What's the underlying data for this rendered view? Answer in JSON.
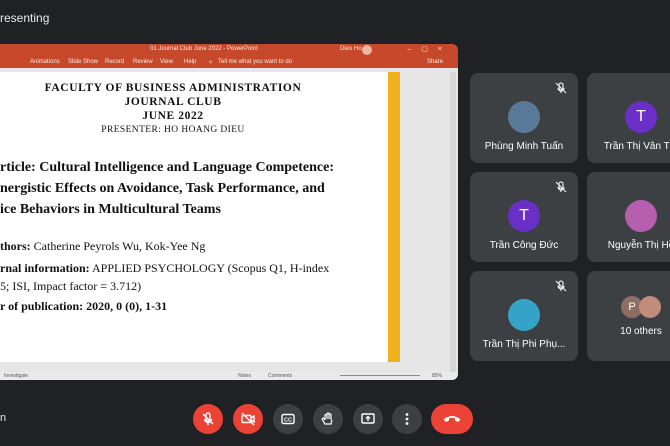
{
  "meet": {
    "top_title": "resenting",
    "bottom_left": "n"
  },
  "powerpoint": {
    "window_title": "01 Journal Club June 2022 - PowerPoint",
    "user": "Dieu Ho",
    "ribbon_tabs": [
      "Animations",
      "Slide Show",
      "Record",
      "Review",
      "View",
      "Help"
    ],
    "tell_me": "Tell me what you want to do",
    "share": "Share",
    "status_left": "Investigate",
    "status_notes": "Notes",
    "status_comments": "Comments",
    "zoom": "85%"
  },
  "slide": {
    "line1": "FACULTY OF BUSINESS ADMINISTRATION",
    "line2": "JOURNAL CLUB",
    "line3": "JUNE 2022",
    "presenter": "PRESENTER: HO HOANG DIEU",
    "article_line1": "rticle: Cultural Intelligence and Language Competence:",
    "article_line2": "nergistic Effects on Avoidance, Task Performance, and",
    "article_line3": "ice Behaviors in Multicultural Teams",
    "authors_label": "thors:",
    "authors_value": " Catherine Peyrols Wu, Kok-Yee Ng",
    "journal_label": "rnal information:",
    "journal_value": " APPLIED PSYCHOLOGY (Scopus Q1, H-index",
    "journal_line2": "5; ISI, Impact factor = 3.712)",
    "year_label": "r of publication:",
    "year_value": " 2020, 0 (0), 1-31"
  },
  "participants": [
    {
      "name": "Phùng Minh Tuấn",
      "avatar_type": "photo",
      "muted": true
    },
    {
      "name": "Trần Thị Vân Tra",
      "avatar_type": "initial",
      "initial": "T",
      "muted": false
    },
    {
      "name": "Trần Công Đức",
      "avatar_type": "initial",
      "initial": "T",
      "muted": true
    },
    {
      "name": "Nguyễn Thị Hồ",
      "avatar_type": "photo",
      "muted": false
    },
    {
      "name": "Trần Thị Phi Phụ...",
      "avatar_type": "photo",
      "muted": true
    },
    {
      "name": "10 others",
      "avatar_type": "group",
      "initial": "P",
      "muted": false
    }
  ],
  "controls": [
    "mic-off",
    "camera-off",
    "captions",
    "raise-hand",
    "present-now",
    "more-options",
    "leave-call"
  ],
  "colors": {
    "background": "#202124",
    "tile": "#3c4043",
    "danger": "#ea4335",
    "powerpoint": "#c5492a",
    "slide_accent": "#f2b01e",
    "avatar_purple": "#6a2fc7"
  }
}
